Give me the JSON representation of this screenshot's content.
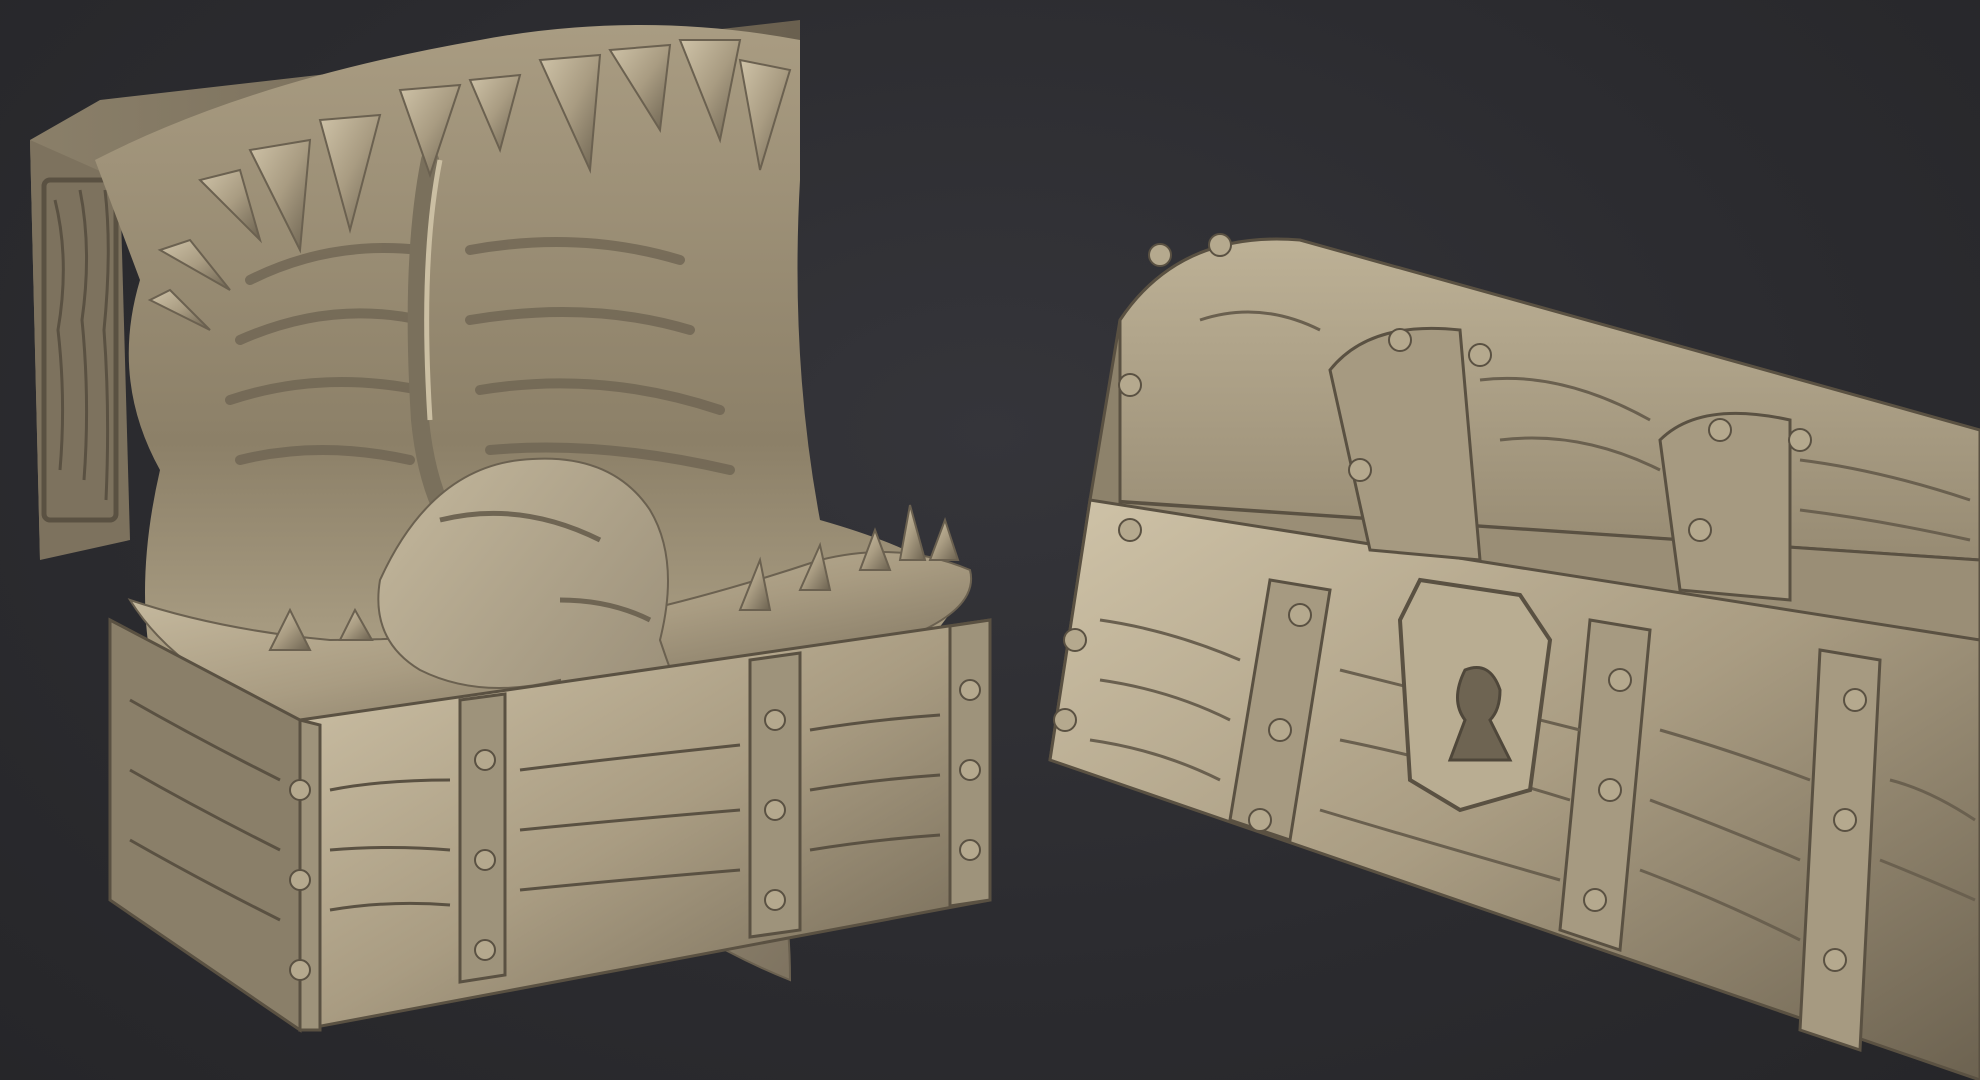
{
  "scene": {
    "background_color": "#2d2d30",
    "material_color": "#a99c82",
    "material_highlight": "#cfc3a8",
    "material_shadow": "#5e5545",
    "objects": [
      {
        "name": "mimic-chest-open",
        "icon": "open-monster-chest"
      },
      {
        "name": "closed-treasure-chest",
        "icon": "locked-chest"
      }
    ]
  }
}
